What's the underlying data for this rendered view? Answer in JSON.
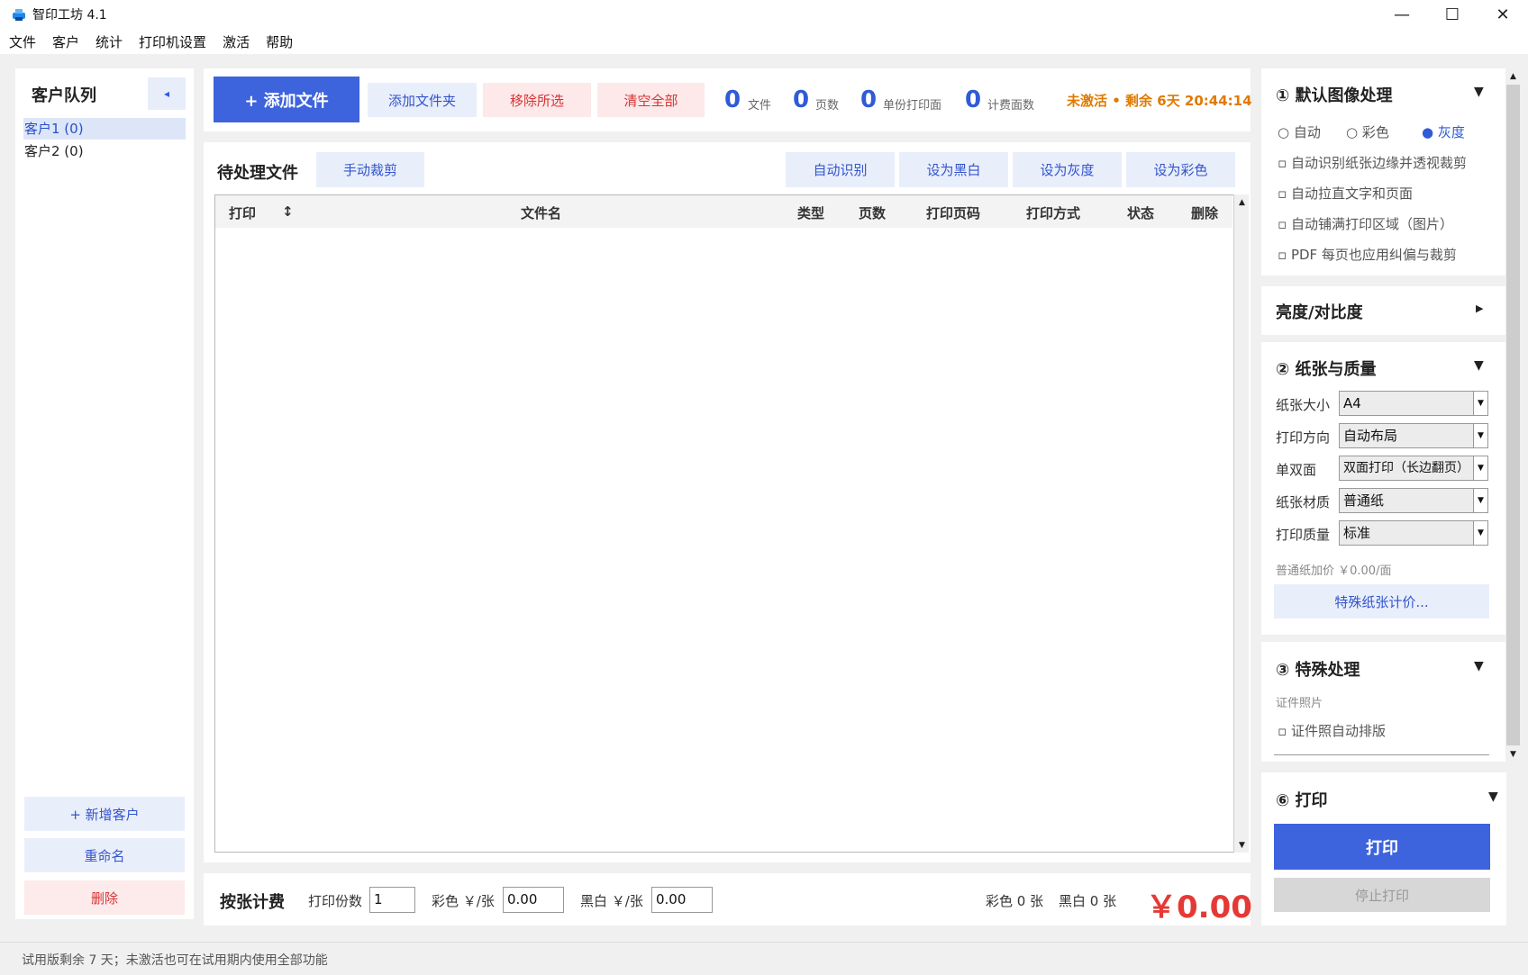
{
  "window": {
    "title": "智印工坊 4.1",
    "minimize": "—",
    "maximize": "☐",
    "close": "✕"
  },
  "menu": [
    "文件",
    "客户",
    "统计",
    "打印机设置",
    "激活",
    "帮助"
  ],
  "customers": {
    "title": "客户队列",
    "collapse": "◂",
    "items": [
      "客户1  (0)",
      "客户2  (0)"
    ],
    "add": "+  新增客户",
    "rename": "重命名",
    "delete": "删除"
  },
  "toolbar": {
    "add_file": "+  添加文件",
    "add_folder": "添加文件夹",
    "remove_selected": "移除所选",
    "clear_all": "清空全部",
    "stats": [
      {
        "value": "0",
        "label": "文件"
      },
      {
        "value": "0",
        "label": "页数"
      },
      {
        "value": "0",
        "label": "单份打印面"
      },
      {
        "value": "0",
        "label": "计费面数"
      }
    ],
    "trial": "未激活 • 剩余 6天 20:44:14"
  },
  "files": {
    "title": "待处理文件",
    "manual_crop": "手动裁剪",
    "auto_detect": "自动识别",
    "set_bw": "设为黑白",
    "set_gray": "设为灰度",
    "set_color": "设为彩色",
    "columns": [
      "打印",
      "↕",
      "文件名",
      "类型",
      "页数",
      "打印页码",
      "打印方式",
      "状态",
      "删除"
    ]
  },
  "billing": {
    "title": "按张计费",
    "copies_label": "打印份数",
    "copies": "1",
    "color_label": "彩色 ￥/张",
    "color_price": "0.00",
    "bw_label": "黑白 ￥/张",
    "bw_price": "0.00",
    "color_sheets": "彩色 0 张",
    "bw_sheets": "黑白 0 张",
    "total": "￥0.00"
  },
  "image_processing": {
    "title": "① 默认图像处理",
    "modes": [
      "自动",
      "彩色",
      "灰度"
    ],
    "selected_mode": "灰度",
    "options": [
      "自动识别纸张边缘并透视裁剪",
      "自动拉直文字和页面",
      "自动铺满打印区域（图片）",
      "PDF 每页也应用纠偏与裁剪"
    ]
  },
  "brightness": {
    "title": "亮度/对比度"
  },
  "paper": {
    "title": "② 纸张与质量",
    "fields": [
      {
        "label": "纸张大小",
        "value": "A4"
      },
      {
        "label": "打印方向",
        "value": "自动布局"
      },
      {
        "label": "单双面",
        "value": "双面打印（长边翻页）"
      },
      {
        "label": "纸张材质",
        "value": "普通纸"
      },
      {
        "label": "打印质量",
        "value": "标准"
      }
    ],
    "price_note": "普通纸加价 ￥0.00/面",
    "special_price_button": "特殊纸张计价..."
  },
  "special": {
    "title": "③ 特殊处理",
    "subtitle": "证件照片",
    "option": "证件照自动排版"
  },
  "print": {
    "title": "⑥ 打印",
    "print_button": "打印",
    "stop_button": "停止打印"
  },
  "status_bar": "试用版剩余 7 天；未激活也可在试用期内使用全部功能",
  "colors": {
    "accent": "#3d63dd",
    "danger": "#e53935",
    "warning": "#e07a00"
  }
}
